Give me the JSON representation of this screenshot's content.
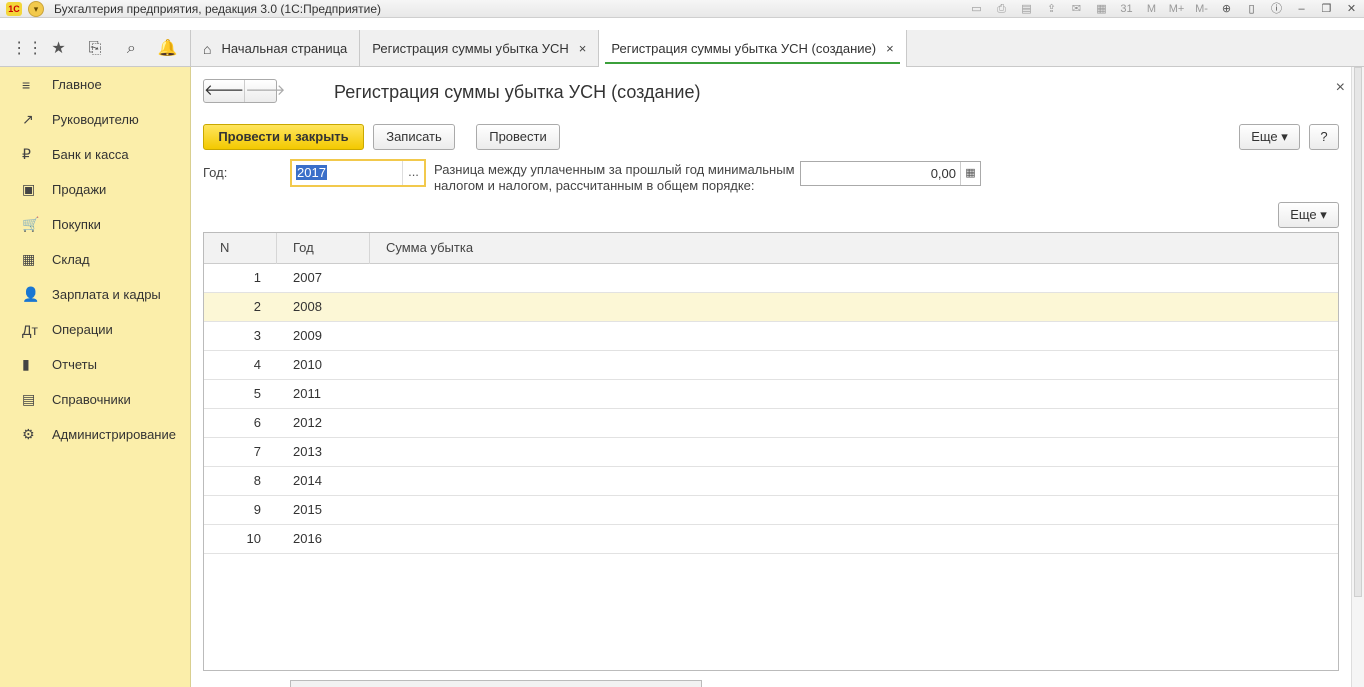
{
  "app": {
    "title": "Бухгалтерия предприятия, редакция 3.0  (1С:Предприятие)",
    "logo": "1С"
  },
  "toolbar_icons": [
    "save-icon",
    "print-icon",
    "preview-icon",
    "upload-icon",
    "mail-icon",
    "calculator-icon",
    "calendar-icon",
    "m-icon",
    "mplus-icon",
    "mminus-icon",
    "zoom-icon",
    "panel-icon",
    "info-icon",
    "minimize-icon",
    "restore-icon",
    "close-icon"
  ],
  "toolbar_icon_glyphs": [
    "▭",
    "⎙",
    "▤",
    "⇪",
    "✉",
    "▦",
    "31",
    "M",
    "M+",
    "M-",
    "⊕",
    "▯",
    "ⓘ",
    "–",
    "❐",
    "✕"
  ],
  "tabs": [
    {
      "label": "Начальная страница",
      "home": true
    },
    {
      "label": "Регистрация суммы убытка УСН",
      "close": "×"
    },
    {
      "label": "Регистрация суммы убытка УСН (создание)",
      "close": "×",
      "active": true
    }
  ],
  "sidebar": {
    "items": [
      {
        "label": "Главное",
        "icon": "≡"
      },
      {
        "label": "Руководителю",
        "icon": "↗"
      },
      {
        "label": "Банк и касса",
        "icon": "₽"
      },
      {
        "label": "Продажи",
        "icon": "▣"
      },
      {
        "label": "Покупки",
        "icon": "🛒"
      },
      {
        "label": "Склад",
        "icon": "▦"
      },
      {
        "label": "Зарплата и кадры",
        "icon": "👤"
      },
      {
        "label": "Операции",
        "icon": "Дт"
      },
      {
        "label": "Отчеты",
        "icon": "▮"
      },
      {
        "label": "Справочники",
        "icon": "▤"
      },
      {
        "label": "Администрирование",
        "icon": "⚙"
      }
    ]
  },
  "form": {
    "title": "Регистрация суммы убытка УСН (создание)",
    "buttons": {
      "post_close": "Провести и закрыть",
      "save": "Записать",
      "post": "Провести",
      "more": "Еще ▾",
      "help": "?"
    },
    "year_label": "Год:",
    "year_value": "2017",
    "year_dots": "...",
    "diff_label": "Разница между уплаченным за прошлый год минимальным налогом и налогом, рассчитанным в общем порядке:",
    "diff_value": "0,00",
    "table_more": "Еще ▾"
  },
  "table": {
    "columns": [
      "N",
      "Год",
      "Сумма убытка"
    ],
    "rows": [
      {
        "n": "1",
        "year": "2007",
        "sum": ""
      },
      {
        "n": "2",
        "year": "2008",
        "sum": ""
      },
      {
        "n": "3",
        "year": "2009",
        "sum": ""
      },
      {
        "n": "4",
        "year": "2010",
        "sum": ""
      },
      {
        "n": "5",
        "year": "2011",
        "sum": ""
      },
      {
        "n": "6",
        "year": "2012",
        "sum": ""
      },
      {
        "n": "7",
        "year": "2013",
        "sum": ""
      },
      {
        "n": "8",
        "year": "2014",
        "sum": ""
      },
      {
        "n": "9",
        "year": "2015",
        "sum": ""
      },
      {
        "n": "10",
        "year": "2016",
        "sum": ""
      }
    ],
    "selected_row": 1
  }
}
